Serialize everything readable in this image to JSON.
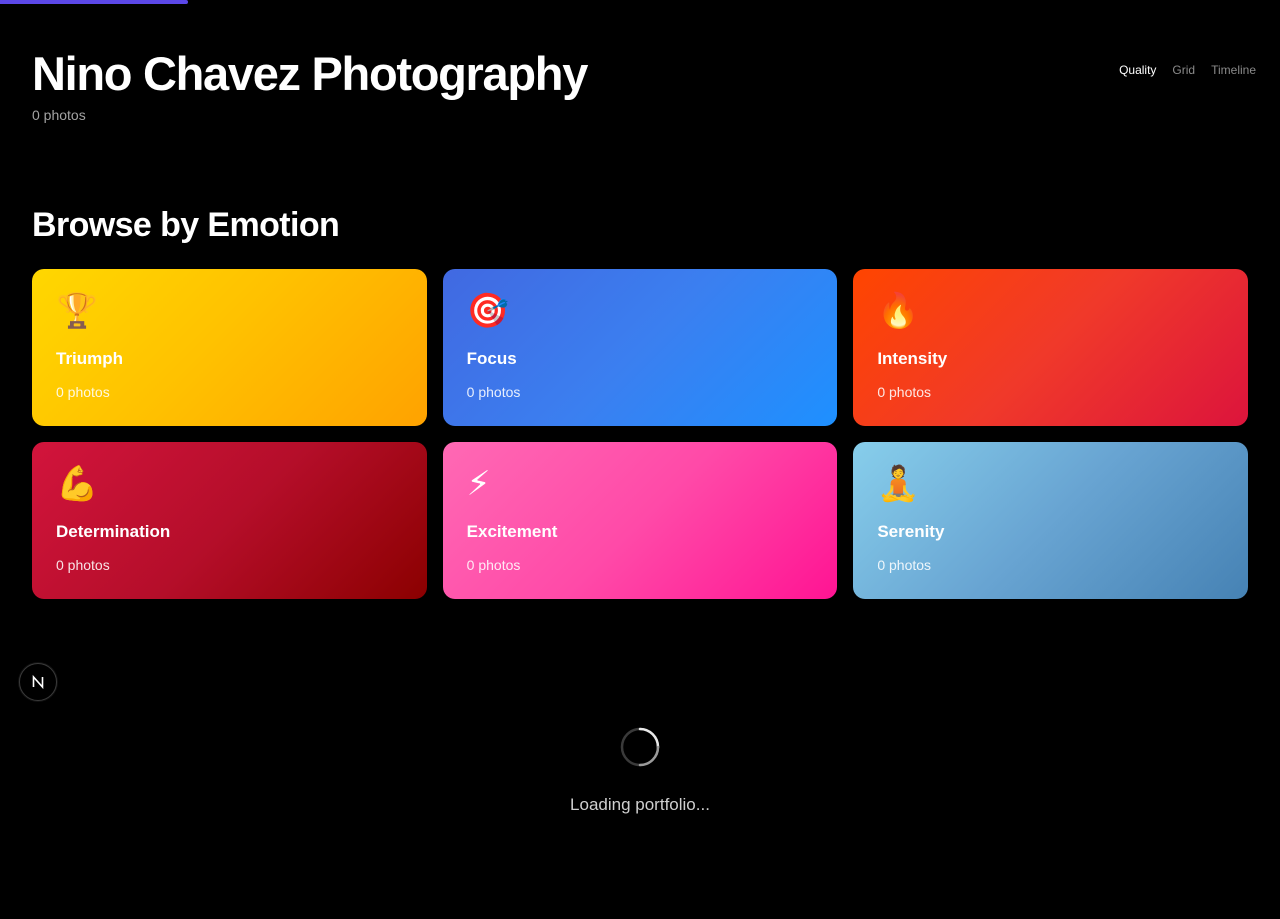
{
  "header": {
    "title": "Nino Chavez Photography",
    "count": "0 photos",
    "views": [
      "Quality",
      "Grid",
      "Timeline"
    ],
    "active_view": "Quality"
  },
  "emotions": {
    "title": "Browse by Emotion",
    "cards": [
      {
        "icon": "trophy-icon",
        "emoji": "🏆",
        "label": "Triumph",
        "count": "0 photos"
      },
      {
        "icon": "target-icon",
        "emoji": "🎯",
        "label": "Focus",
        "count": "0 photos"
      },
      {
        "icon": "fire-icon",
        "emoji": "🔥",
        "label": "Intensity",
        "count": "0 photos"
      },
      {
        "icon": "flexed-biceps-icon",
        "emoji": "💪",
        "label": "Determination",
        "count": "0 photos"
      },
      {
        "icon": "lightning-icon",
        "emoji": "⚡",
        "label": "Excitement",
        "count": "0 photos"
      },
      {
        "icon": "meditation-icon",
        "emoji": "🧘",
        "label": "Serenity",
        "count": "0 photos"
      }
    ]
  },
  "loading": {
    "text": "Loading portfolio..."
  },
  "colors": {
    "progress_accent": "#5b47e8",
    "triumph": "#ffd700",
    "focus": "#4169e1",
    "intensity": "#ff4500",
    "determination": "#dc143c",
    "excitement": "#ff69b4",
    "serenity": "#87ceeb"
  }
}
